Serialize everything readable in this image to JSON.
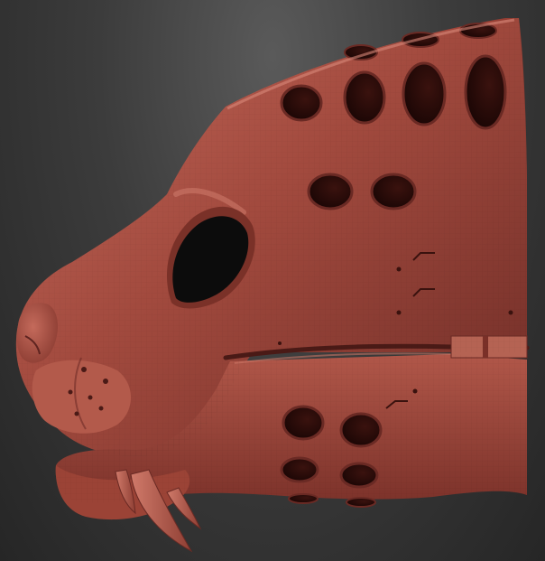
{
  "scene": {
    "background_top": "#5a5a5a",
    "background_bottom": "#262626",
    "material": "#a24a3e",
    "material_light": "#c56a5c",
    "material_dark": "#5e2420",
    "hole_color": "#2a0c0a",
    "tooth_color": "#b85a4c",
    "subject": "sculpted-feline-mask-head",
    "holes": {
      "top_row": 4,
      "middle_row": 2,
      "jaw_rows": 2,
      "jaw_per_row": 2
    }
  }
}
